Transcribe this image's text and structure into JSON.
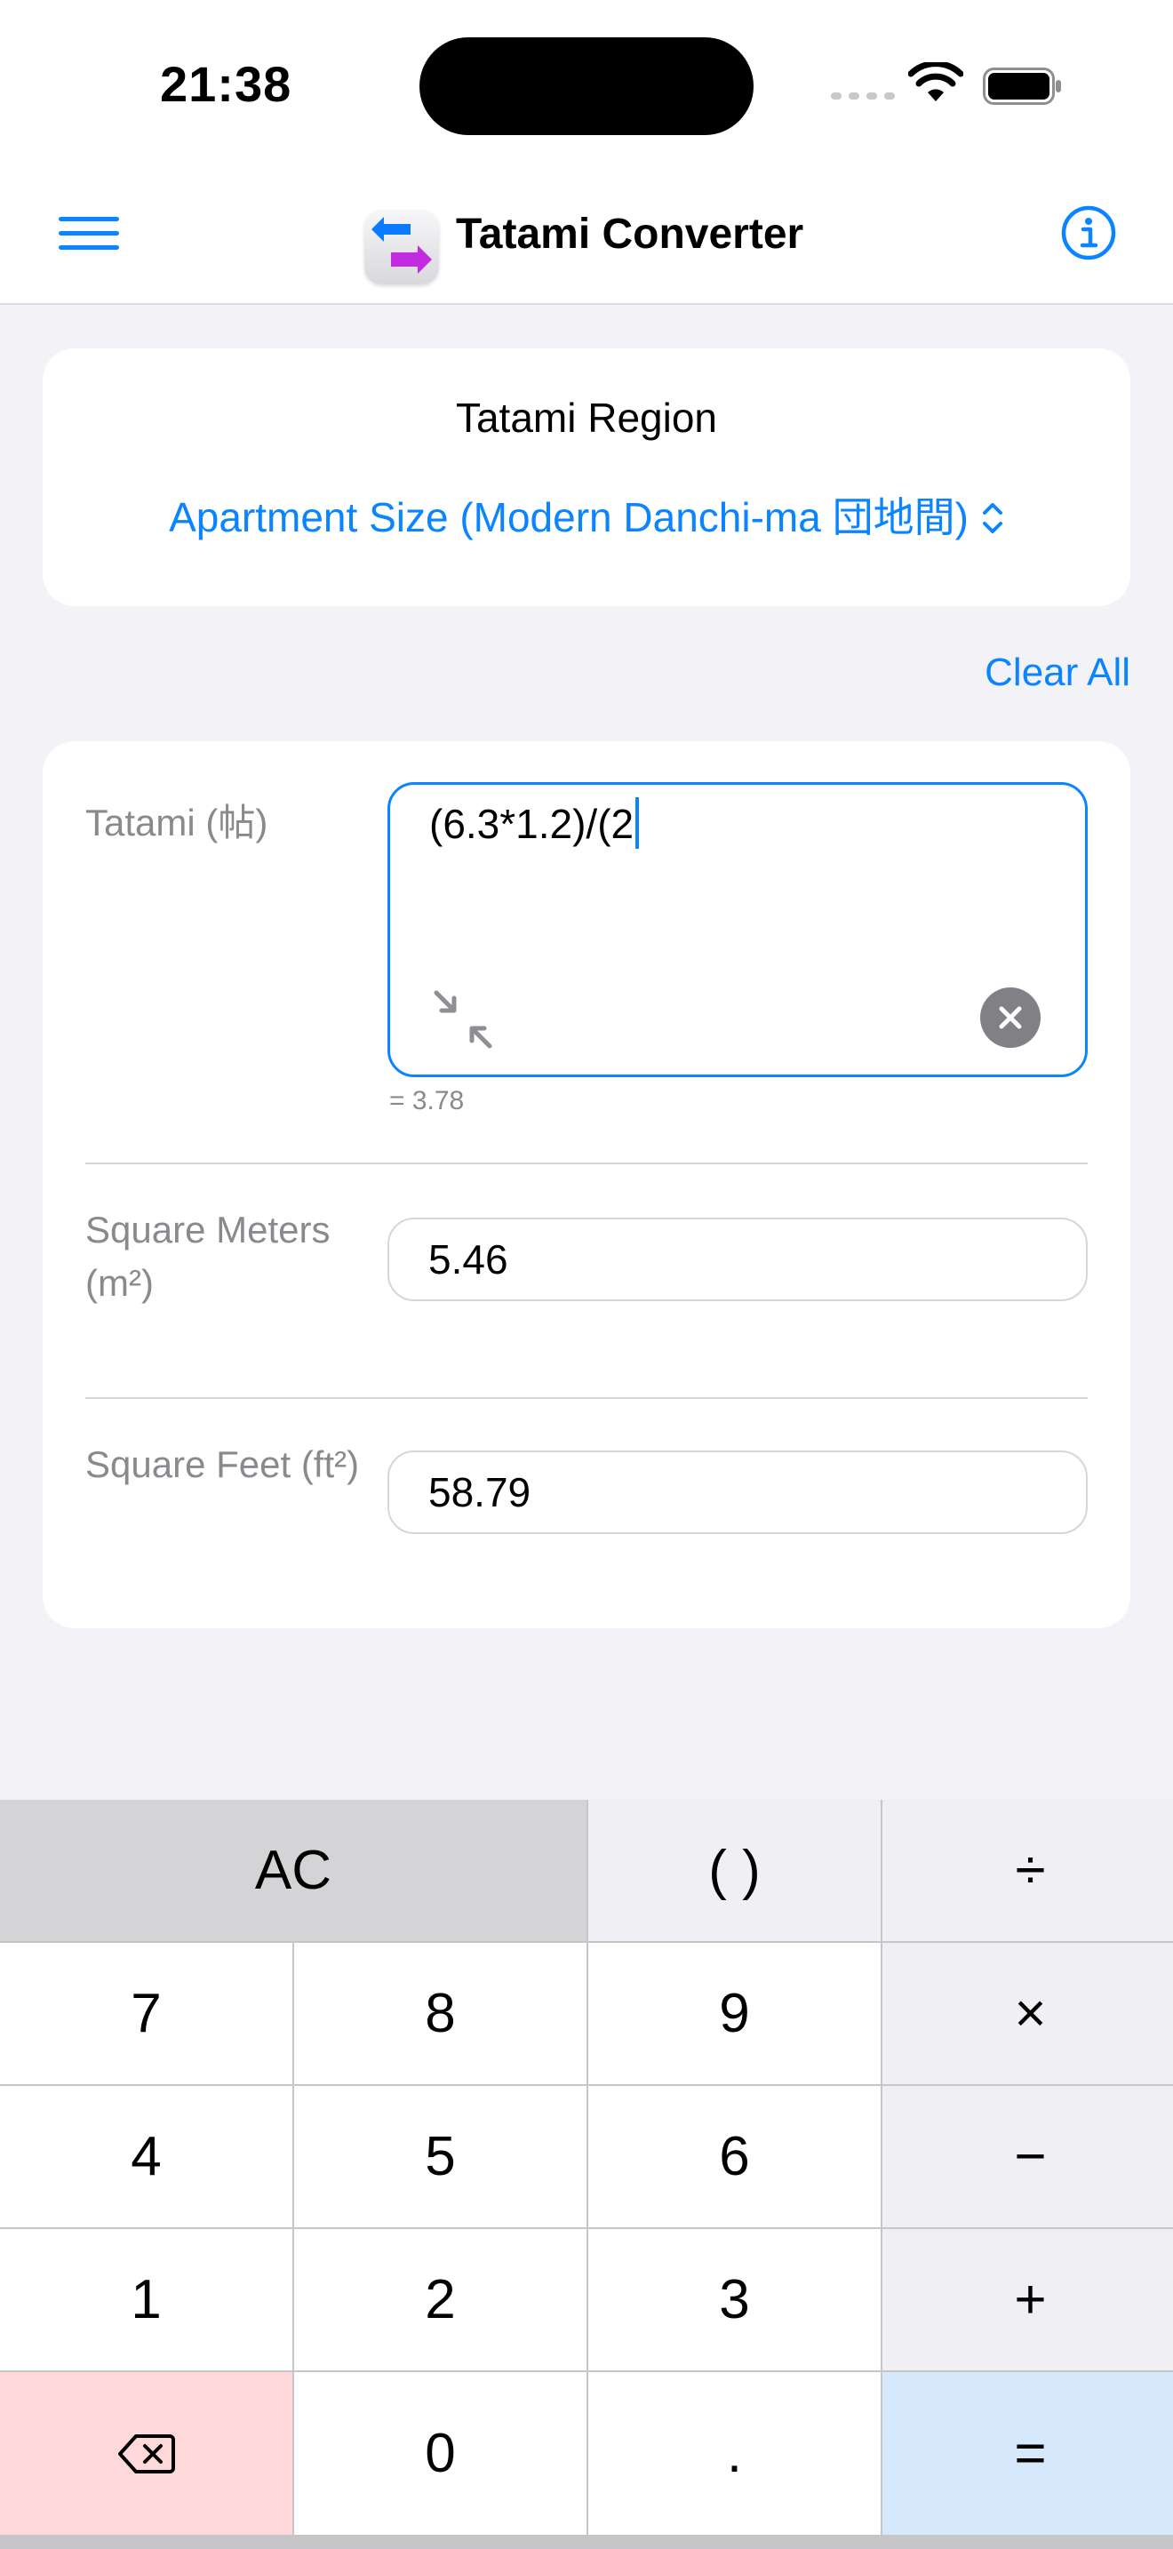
{
  "status_bar": {
    "time": "21:38"
  },
  "nav": {
    "title": "Tatami Converter"
  },
  "region": {
    "label": "Tatami Region",
    "selected": "Apartment Size (Modern Danchi-ma 団地間)"
  },
  "clear_all_label": "Clear All",
  "converter": {
    "tatami": {
      "label": "Tatami (帖)",
      "expression": "(6.3*1.2)/(2",
      "result": "= 3.78"
    },
    "square_meters": {
      "label": "Square Meters (m²)",
      "value": "5.46"
    },
    "square_feet": {
      "label": "Square Feet (ft²)",
      "value": "58.79"
    }
  },
  "keypad": {
    "ac": "AC",
    "parens": "( )",
    "divide": "÷",
    "k7": "7",
    "k8": "8",
    "k9": "9",
    "multiply": "×",
    "k4": "4",
    "k5": "5",
    "k6": "6",
    "minus": "−",
    "k1": "1",
    "k2": "2",
    "k3": "3",
    "plus": "+",
    "k0": "0",
    "dot": ".",
    "equals": "="
  },
  "colors": {
    "accent": "#0a84ff",
    "delete_key": "#ffd9d9",
    "equals_key": "#d6e8fc",
    "ac_key": "#d4d4d6"
  }
}
